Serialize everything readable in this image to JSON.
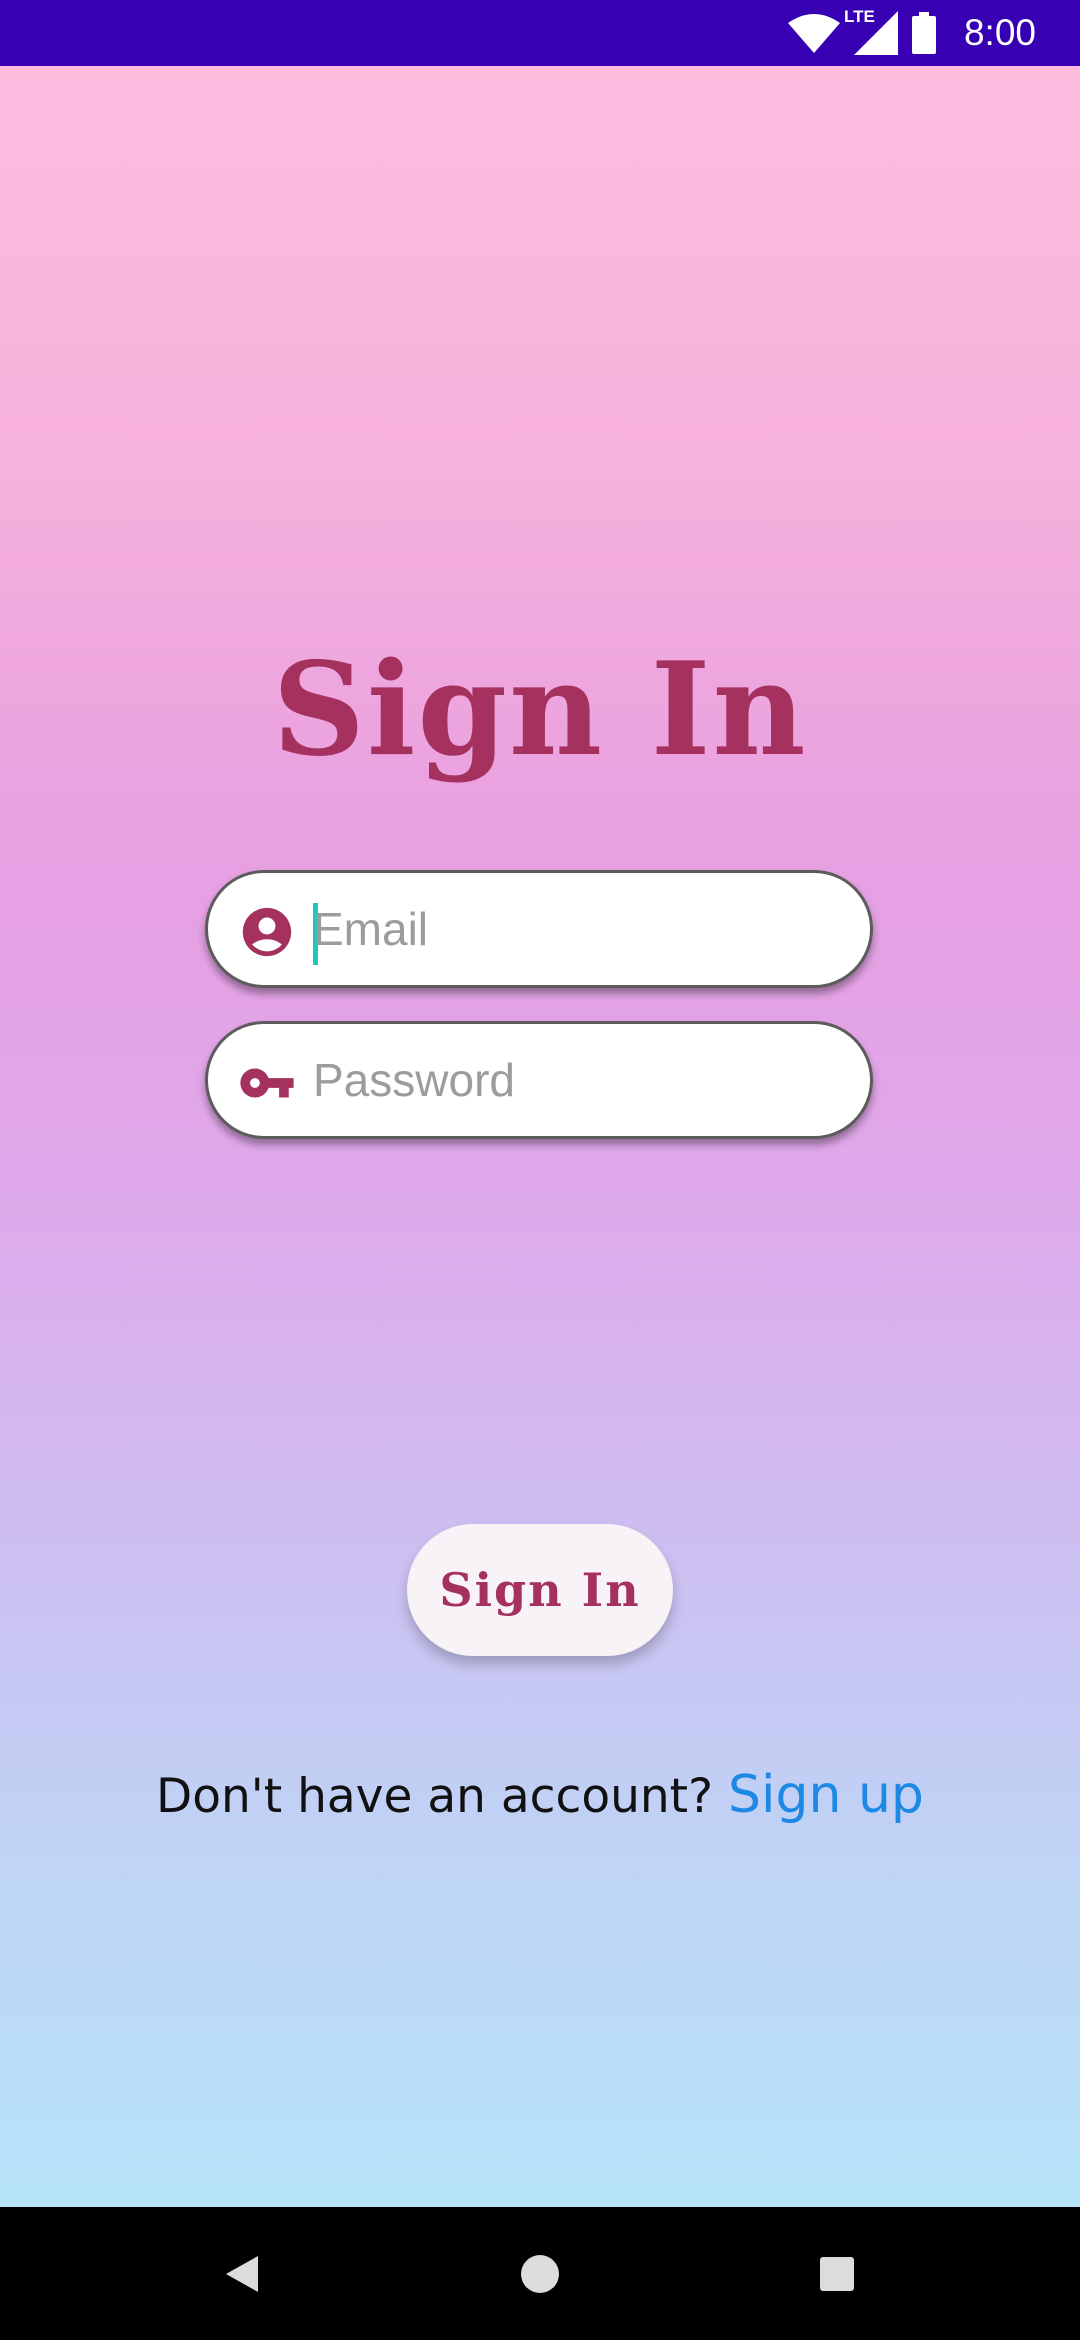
{
  "status_bar": {
    "time": "8:00",
    "network_label": "LTE",
    "background": "#3700b3"
  },
  "title": "Sign In",
  "email_field": {
    "placeholder": "Email",
    "value": "",
    "icon": "account-circle-icon"
  },
  "password_field": {
    "placeholder": "Password",
    "value": "",
    "icon": "key-icon"
  },
  "sign_in_button": {
    "label": "Sign In"
  },
  "signup_prompt": {
    "text": "Don't have an account?",
    "link_label": "Sign up"
  },
  "nav_bar": {
    "back_icon": "back-triangle-icon",
    "home_icon": "home-circle-icon",
    "recents_icon": "recents-square-icon"
  },
  "colors": {
    "accent": "#a5315f",
    "link": "#1e88e5",
    "gradient_top": "#ffbbde",
    "gradient_bottom": "#b6e3f8"
  }
}
